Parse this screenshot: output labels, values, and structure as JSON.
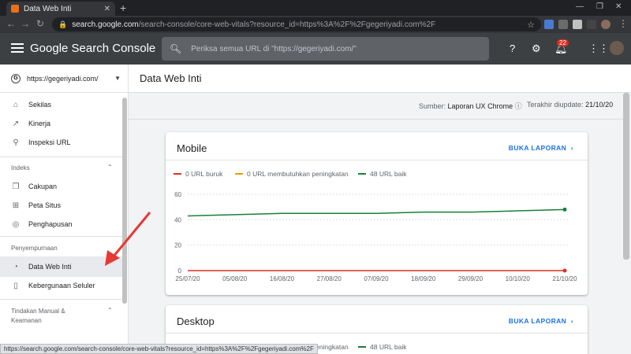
{
  "browser": {
    "tab_title": "Data Web Inti",
    "url_host": "search.google.com",
    "url_rest": "/search-console/core-web-vitals?resource_id=https%3A%2F%2Fgegeriyadi.com%2F",
    "status_url": "https://search.google.com/search-console/core-web-vitals?resource_id=https%3A%2F%2Fgegeriyadi.com%2F"
  },
  "header": {
    "brand": "Google Search Console",
    "search_placeholder": "Periksa semua URL di \"https://gegeriyadi.com/\"",
    "notification_count": "22"
  },
  "sidebar": {
    "property": "https://gegeriyadi.com/",
    "items_top": [
      {
        "label": "Sekilas",
        "icon": "home-icon"
      },
      {
        "label": "Kinerja",
        "icon": "trend-icon"
      },
      {
        "label": "Inspeksi URL",
        "icon": "search-icon"
      }
    ],
    "section_index": "Indeks",
    "items_index": [
      {
        "label": "Cakupan",
        "icon": "copy-icon"
      },
      {
        "label": "Peta Situs",
        "icon": "sitemap-icon"
      },
      {
        "label": "Penghapusan",
        "icon": "eye-off-icon"
      }
    ],
    "section_enhance": "Penyempurnaan",
    "items_enhance": [
      {
        "label": "Data Web Inti",
        "icon": "gauge-icon"
      },
      {
        "label": "Kebergunaan Seluler",
        "icon": "phone-icon"
      }
    ],
    "section_manual": "Tindakan Manual &",
    "section_manual_2": "Keamanan"
  },
  "main": {
    "page_title": "Data Web Inti",
    "source_label": "Sumber:",
    "source_value": "Laporan UX Chrome",
    "updated_label": "Terakhir diupdate:",
    "updated_value": "21/10/20"
  },
  "cards": {
    "mobile": {
      "title": "Mobile",
      "open_report": "BUKA LAPORAN",
      "legend_poor": "0 URL buruk",
      "legend_ni": "0 URL membutuhkan peningkatan",
      "legend_good": "48 URL baik"
    },
    "desktop": {
      "title": "Desktop",
      "open_report": "BUKA LAPORAN",
      "legend_ni": "0 URL membutuhkan peningkatan",
      "legend_good": "48 URL baik"
    }
  },
  "colors": {
    "poor": "#d93025",
    "needs_improvement": "#f29900",
    "good": "#188038",
    "link": "#1a73e8",
    "arrow": "#e53935"
  },
  "chart_data": {
    "type": "line",
    "x": [
      "25/07/20",
      "05/08/20",
      "16/08/20",
      "27/08/20",
      "07/09/20",
      "18/09/20",
      "29/09/20",
      "10/10/20",
      "21/10/20"
    ],
    "ylim": [
      0,
      60
    ],
    "yticks": [
      "0",
      "20",
      "40",
      "60"
    ],
    "series": [
      {
        "name": "48 URL baik",
        "color": "#188038",
        "values": [
          43,
          44,
          45,
          45,
          45,
          46,
          46,
          47,
          48
        ]
      },
      {
        "name": "0 URL buruk",
        "color": "#d93025",
        "values": [
          0,
          0,
          0,
          0,
          0,
          0,
          0,
          0,
          0
        ]
      }
    ]
  }
}
